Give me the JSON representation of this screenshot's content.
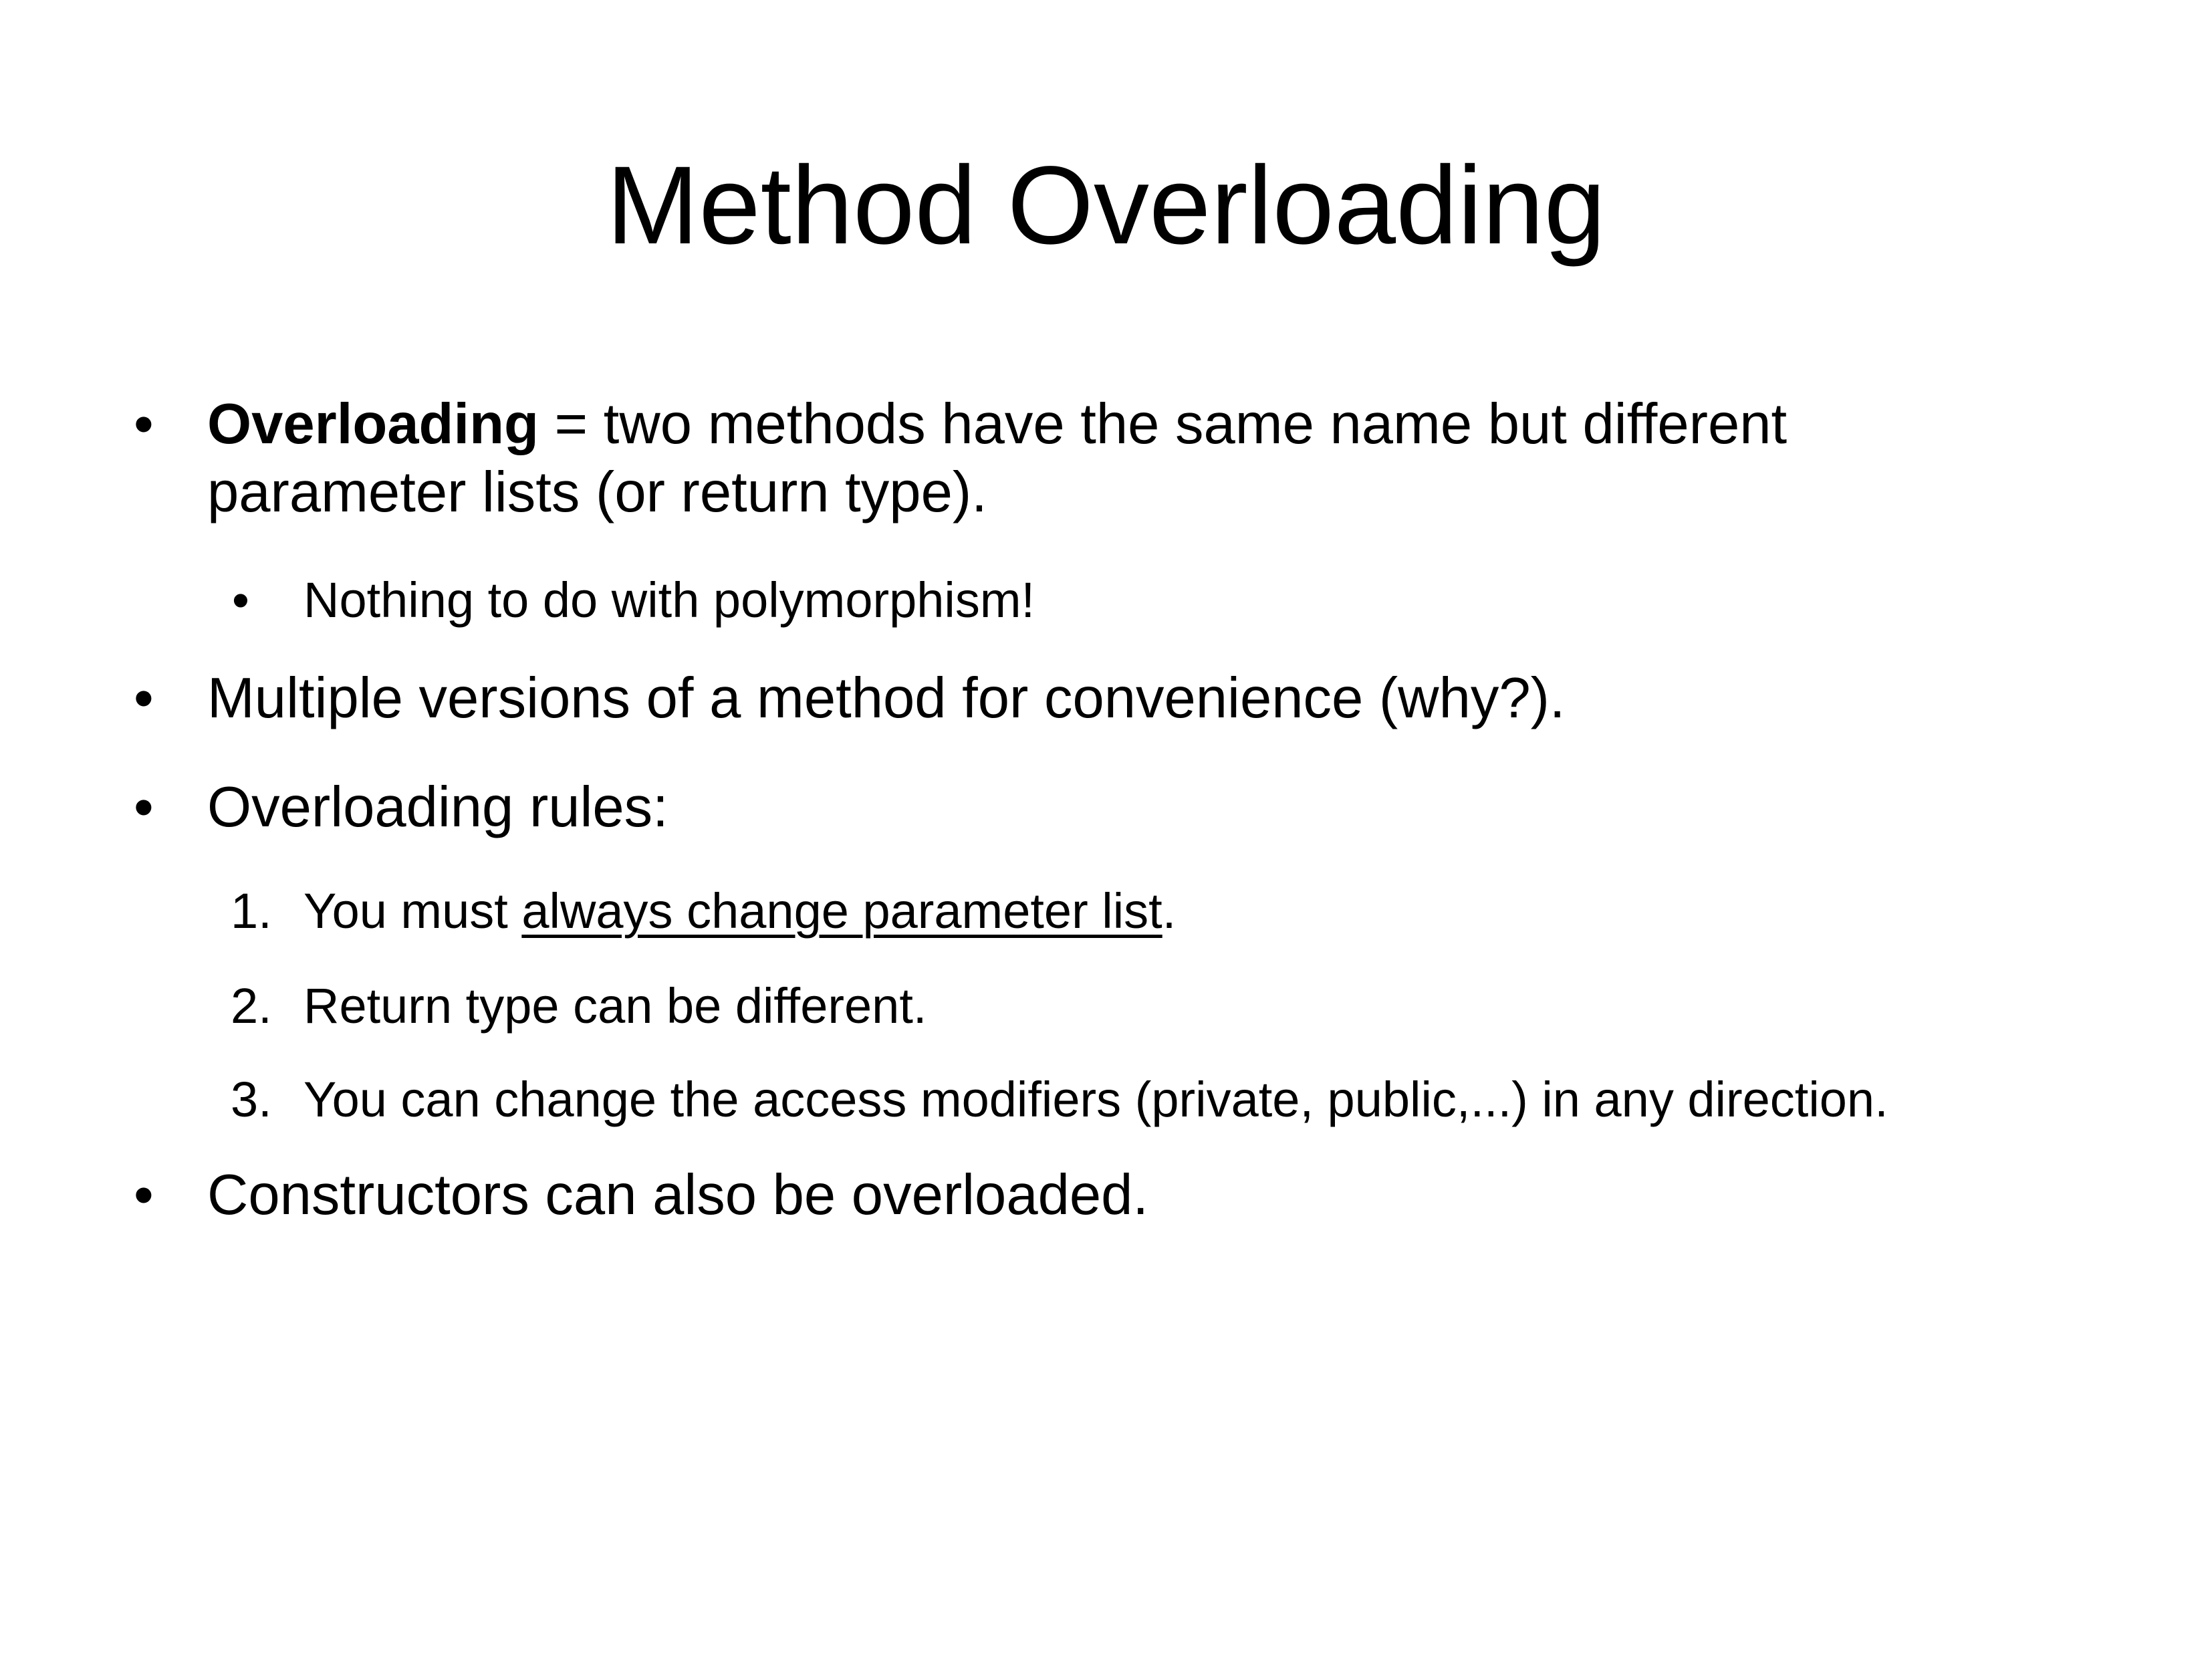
{
  "slide": {
    "title": "Method Overloading",
    "bullet_symbol": "•",
    "items": [
      {
        "bold": "Overloading",
        "text_line1": " = two methods have the same name but different",
        "text_line2": "parameter lists (or return type)."
      },
      {
        "sub_text": "Nothing to do with polymorphism!"
      },
      {
        "text": "Multiple versions of a method for convenience (why?)."
      },
      {
        "text": "Overloading rules:"
      },
      {
        "number": "1.",
        "prefix": "You must ",
        "underlined": "always change parameter list",
        "suffix": "."
      },
      {
        "number": "2.",
        "text": "Return type can be different."
      },
      {
        "number": "3.",
        "text": "You can change the access modifiers (private, public,...) in any direction."
      },
      {
        "text": "Constructors can also be overloaded."
      }
    ]
  }
}
